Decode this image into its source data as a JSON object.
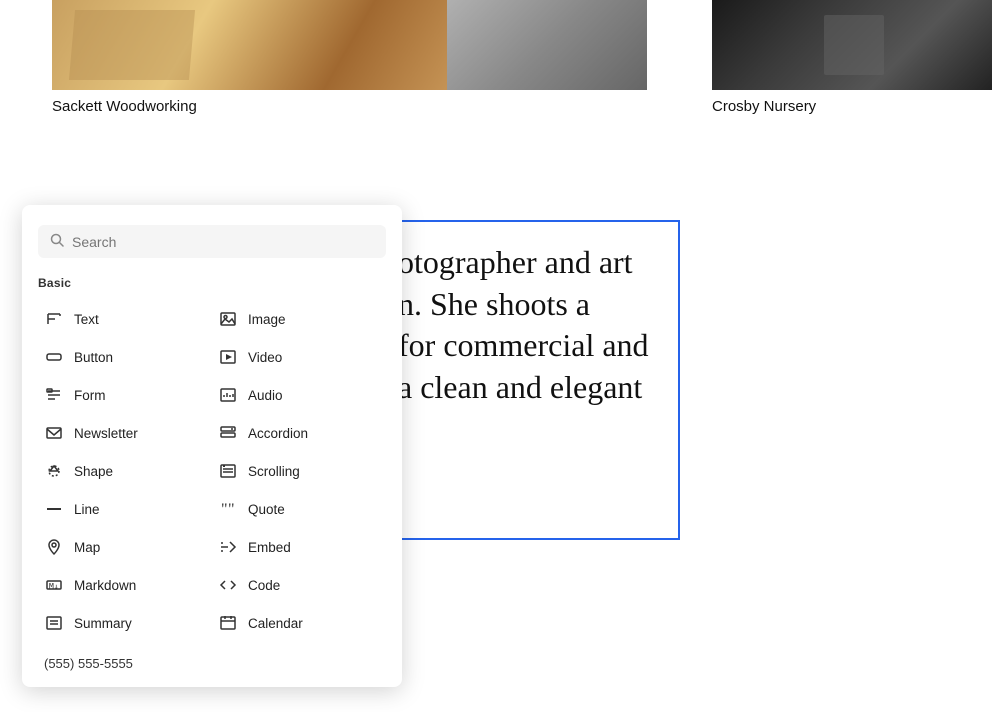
{
  "gallery": {
    "left_title": "Sackett Woodworking",
    "right_title": "Crosby Nursery"
  },
  "search": {
    "placeholder": "Search",
    "value": ""
  },
  "panel": {
    "section_label": "Basic",
    "items_left": [
      {
        "id": "text",
        "label": "Text",
        "icon": "text-icon"
      },
      {
        "id": "button",
        "label": "Button",
        "icon": "button-icon"
      },
      {
        "id": "form",
        "label": "Form",
        "icon": "form-icon"
      },
      {
        "id": "newsletter",
        "label": "Newsletter",
        "icon": "newsletter-icon"
      },
      {
        "id": "shape",
        "label": "Shape",
        "icon": "shape-icon"
      },
      {
        "id": "line",
        "label": "Line",
        "icon": "line-icon"
      },
      {
        "id": "map",
        "label": "Map",
        "icon": "map-icon"
      },
      {
        "id": "markdown",
        "label": "Markdown",
        "icon": "markdown-icon"
      },
      {
        "id": "summary",
        "label": "Summary",
        "icon": "summary-icon"
      }
    ],
    "items_right": [
      {
        "id": "image",
        "label": "Image",
        "icon": "image-icon"
      },
      {
        "id": "video",
        "label": "Video",
        "icon": "video-icon"
      },
      {
        "id": "audio",
        "label": "Audio",
        "icon": "audio-icon"
      },
      {
        "id": "accordion",
        "label": "Accordion",
        "icon": "accordion-icon"
      },
      {
        "id": "scrolling",
        "label": "Scrolling",
        "icon": "scrolling-icon"
      },
      {
        "id": "quote",
        "label": "Quote",
        "icon": "quote-icon"
      },
      {
        "id": "embed",
        "label": "Embed",
        "icon": "embed-icon"
      },
      {
        "id": "code",
        "label": "Code",
        "icon": "code-icon"
      },
      {
        "id": "calendar",
        "label": "Calendar",
        "icon": "calendar-icon"
      }
    ],
    "phone": "(555) 555-5555"
  },
  "content": {
    "text": "otographer and art\nn. She shoots a\nfor commercial and\na clean and elegant"
  }
}
